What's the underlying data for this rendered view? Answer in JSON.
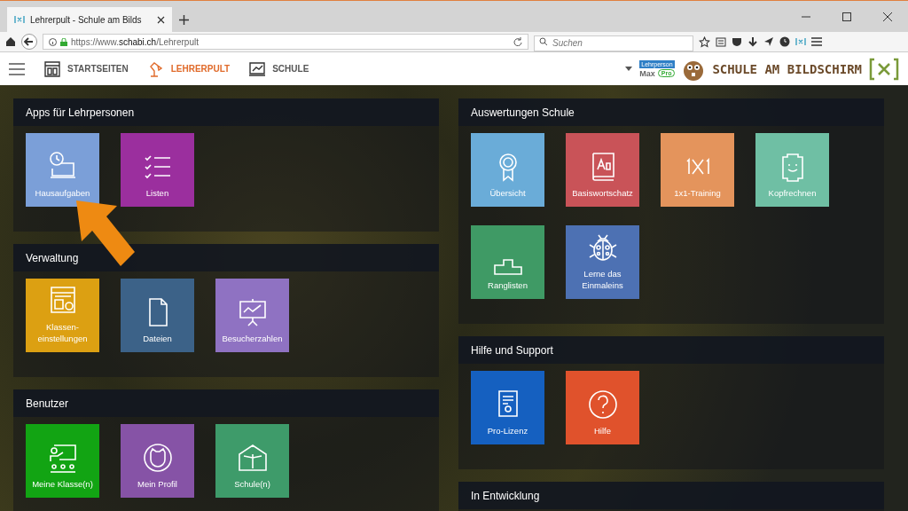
{
  "browser": {
    "tab_title": "Lehrerpult - Schule am Bilds",
    "url_prefix": "https://www.",
    "url_domain": "schabi.ch",
    "url_path": "/Lehrerpult",
    "search": {
      "placeholder": "Suchen"
    }
  },
  "nav": {
    "items": [
      {
        "label": "STARTSEITEN",
        "selected": false
      },
      {
        "label": "LEHRERPULT",
        "selected": true
      },
      {
        "label": "SCHULE",
        "selected": false
      }
    ],
    "user": {
      "role": "Lehrperson",
      "name": "Max",
      "badge": "Pro"
    },
    "logo": "SCHULE AM BILDSCHIRM"
  },
  "columns": [
    [
      {
        "title": "Apps für Lehrpersonen",
        "tiles": [
          {
            "label": "Hausaufgaben",
            "color": "#7b9fd8"
          },
          {
            "label": "Listen",
            "color": "#9b2f9e"
          }
        ]
      },
      {
        "title": "Verwaltung",
        "tiles": [
          {
            "label": "Klassen-einstellungen",
            "color": "#dca012"
          },
          {
            "label": "Dateien",
            "color": "#3c6288"
          },
          {
            "label": "Besucherzahlen",
            "color": "#8f72c2"
          }
        ]
      },
      {
        "title": "Benutzer",
        "tiles": [
          {
            "label": "Meine Klasse(n)",
            "color": "#12a413"
          },
          {
            "label": "Mein Profil",
            "color": "#8653a6"
          },
          {
            "label": "Schule(n)",
            "color": "#3e9b6a"
          }
        ]
      }
    ],
    [
      {
        "title": "Auswertungen Schule",
        "tiles": [
          {
            "label": "Übersicht",
            "color": "#6aacd8"
          },
          {
            "label": "Basiswortschatz",
            "color": "#c95358"
          },
          {
            "label": "1x1-Training",
            "color": "#e4945c"
          },
          {
            "label": "Kopfrechnen",
            "color": "#6fbfa4"
          },
          {
            "label": "Ranglisten",
            "color": "#3f9a65"
          },
          {
            "label": "Lerne das Einmaleins",
            "color": "#4d71b3"
          }
        ]
      },
      {
        "title": "Hilfe und Support",
        "tiles": [
          {
            "label": "Pro-Lizenz",
            "color": "#1560c0"
          },
          {
            "label": "Hilfe",
            "color": "#e0522c"
          }
        ]
      },
      {
        "title": "In Entwicklung"
      }
    ]
  ]
}
